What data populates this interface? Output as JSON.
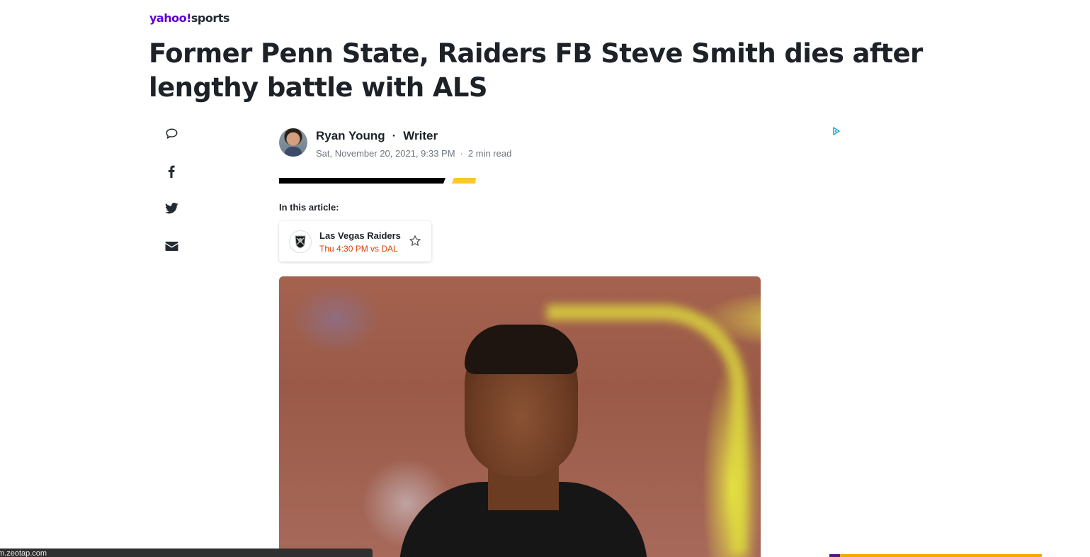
{
  "brand": {
    "logo_part1": "yahoo!",
    "logo_part2": "sports"
  },
  "article": {
    "headline": "Former Penn State, Raiders FB Steve Smith dies after lengthy battle with ALS",
    "author_name": "Ryan Young",
    "author_separator": "·",
    "author_role": "Writer",
    "published": "Sat, November 20, 2021, 9:33 PM",
    "meta_separator": "·",
    "read_time": "2 min read"
  },
  "share": {
    "items": [
      {
        "icon": "comment-icon"
      },
      {
        "icon": "facebook-icon"
      },
      {
        "icon": "twitter-icon"
      },
      {
        "icon": "mail-icon"
      }
    ]
  },
  "in_article": {
    "label": "In this article:",
    "team": {
      "name": "Las Vegas Raiders",
      "next_game": "Thu 4:30 PM vs DAL",
      "logo_icon": "raiders-shield-icon",
      "follow_icon": "star-icon"
    }
  },
  "hero_image": {
    "icon": "player-photo"
  },
  "ad": {
    "adchoices_icon": "adchoices-icon"
  },
  "status_bar": {
    "text": "m.zeotap.com"
  },
  "colors": {
    "brand_purple": "#6001d2",
    "accent_yellow": "#fcc82b",
    "game_time_orange": "#e03d00",
    "adchoices_blue": "#1ea8d8",
    "text_primary": "#1d2228",
    "text_secondary": "#6e7780"
  }
}
